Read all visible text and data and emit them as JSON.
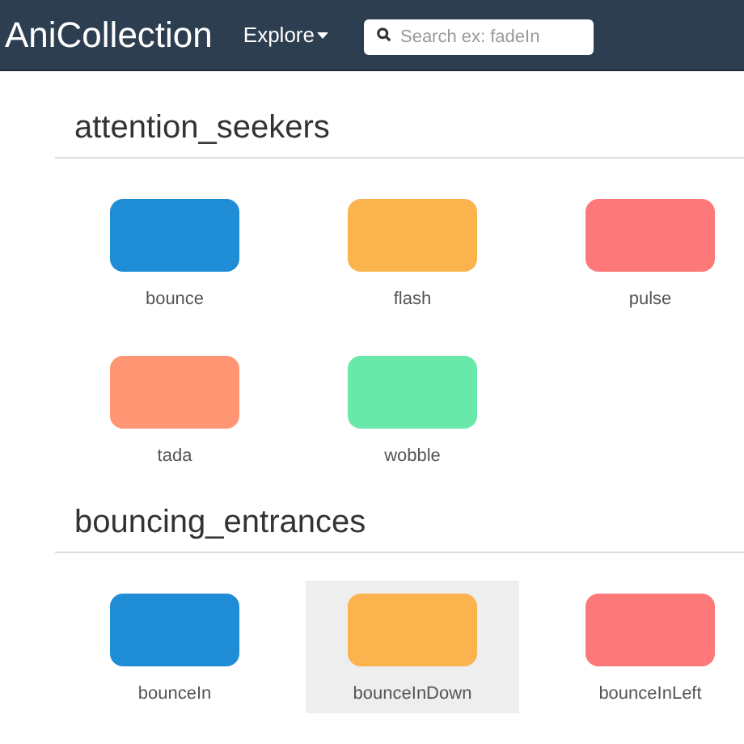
{
  "navbar": {
    "brand": "AniCollection",
    "menu": "Explore",
    "search": {
      "placeholder": "Search ex: fadeIn"
    }
  },
  "sections": [
    {
      "title": "attention_seekers",
      "items": [
        {
          "label": "bounce",
          "color": "#1f8dd6",
          "selected": false
        },
        {
          "label": "flash",
          "color": "#fbb34e",
          "selected": false
        },
        {
          "label": "pulse",
          "color": "#fd7878",
          "selected": false
        },
        {
          "label": "tada",
          "color": "#ff9573",
          "selected": false
        },
        {
          "label": "wobble",
          "color": "#68e8a9",
          "selected": false
        }
      ]
    },
    {
      "title": "bouncing_entrances",
      "items": [
        {
          "label": "bounceIn",
          "color": "#1f8dd6",
          "selected": false
        },
        {
          "label": "bounceInDown",
          "color": "#fbb34e",
          "selected": true
        },
        {
          "label": "bounceInLeft",
          "color": "#fd7878",
          "selected": false
        }
      ]
    }
  ]
}
